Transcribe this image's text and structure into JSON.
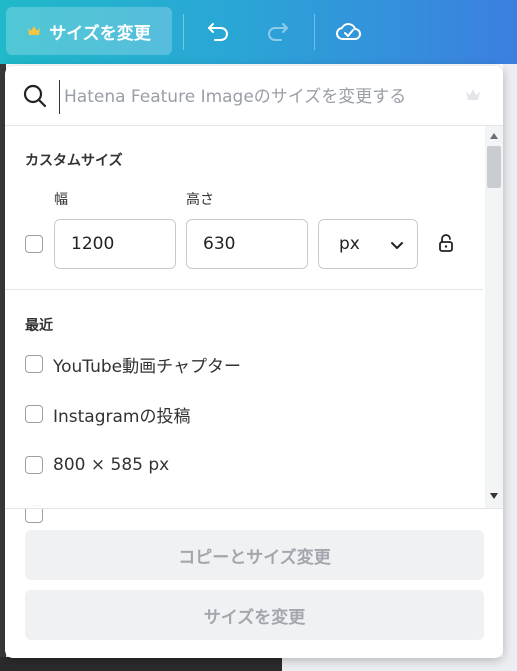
{
  "toolbar": {
    "resize_label": "サイズを変更",
    "icons": [
      "crown-icon",
      "undo-icon",
      "redo-icon",
      "cloud-saved-icon"
    ]
  },
  "search": {
    "placeholder": "Hatena Feature Imageのサイズを変更する",
    "value": ""
  },
  "custom": {
    "title": "カスタムサイズ",
    "width_label": "幅",
    "height_label": "高さ",
    "width_value": "1200",
    "height_value": "630",
    "unit": "px"
  },
  "recent": {
    "title": "最近",
    "items": [
      {
        "label": "YouTube動画チャプター"
      },
      {
        "label": "Instagramの投稿"
      },
      {
        "label": "800 × 585 px"
      },
      {
        "label": ""
      }
    ]
  },
  "footer": {
    "copy_resize_label": "コピーとサイズ変更",
    "resize_label": "サイズを変更"
  },
  "colors": {
    "toolbar_gradient_start": "#1fb9c9",
    "toolbar_gradient_end": "#3c7fe0",
    "disabled_button_bg": "#f0f1f3",
    "disabled_button_text": "#a3a7ad"
  }
}
